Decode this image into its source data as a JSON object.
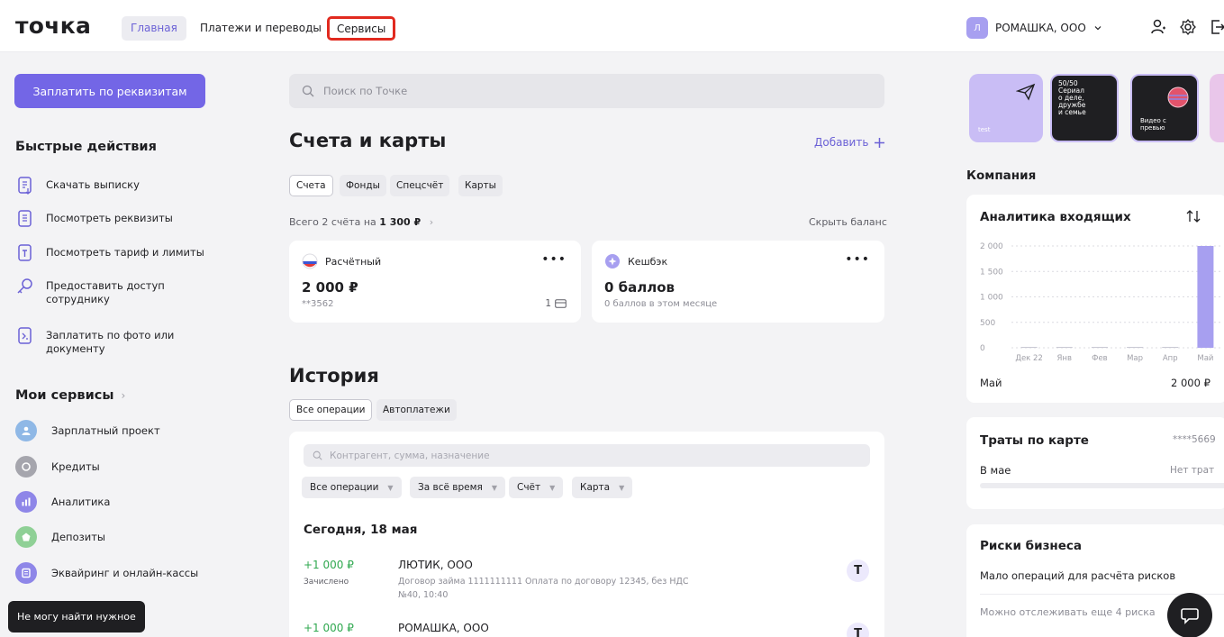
{
  "header": {
    "logo": "точка",
    "nav": [
      "Главная",
      "Платежи и переводы",
      "Сервисы"
    ],
    "company_initial": "Л",
    "company_name": "РОМАШКА, ООО"
  },
  "sidebar": {
    "pay_button": "Заплатить по реквизитам",
    "quick_title": "Быстрые действия",
    "quick_actions": [
      "Скачать выписку",
      "Посмотреть реквизиты",
      "Посмотреть тариф и лимиты",
      "Предоставить доступ\nсотруднику",
      "Заплатить по фото или\nдокументу"
    ],
    "services_title": "Мои сервисы",
    "services": [
      {
        "label": "Зарплатный проект",
        "color": "#8fb8e6"
      },
      {
        "label": "Кредиты",
        "color": "#a5a5ad"
      },
      {
        "label": "Аналитика",
        "color": "#8e86e8"
      },
      {
        "label": "Депозиты",
        "color": "#8fd096"
      },
      {
        "label": "Эквайринг и онлайн-кассы",
        "color": "#8e86e8"
      }
    ],
    "help_pill": "Не могу найти нужное"
  },
  "main": {
    "search_placeholder": "Поиск по Точке",
    "accounts_title": "Счета и карты",
    "add_label": "Добавить",
    "account_tabs": [
      "Счета",
      "Фонды",
      "Спецсчёт",
      "Карты"
    ],
    "summary_prefix": "Всего 2 счёта на ",
    "summary_total": "1 300 ₽",
    "hide_balance": "Скрыть баланс",
    "cards": [
      {
        "title": "Расчётный",
        "amount": "2 000 ₽",
        "sub": "**3562",
        "count": "1"
      },
      {
        "title": "Кешбэк",
        "amount": "0 баллов",
        "sub": "0 баллов в этом месяце"
      }
    ],
    "history_title": "История",
    "history_tabs": [
      "Все операции",
      "Автоплатежи"
    ],
    "history_search_placeholder": "Контрагент, сумма, назначение",
    "filters": [
      "Все операции",
      "За всё время",
      "Счёт",
      "Карта"
    ],
    "day_header": "Сегодня, 18 мая",
    "operations": [
      {
        "amount": "+1 000 ₽",
        "status": "Зачислено",
        "name": "ЛЮТИК, ООО",
        "desc": "Договор займа 1111111111 Оплата по договору 12345, без НДС",
        "meta": "№40, 10:40",
        "badge": "Т"
      },
      {
        "amount": "+1 000 ₽",
        "status": "",
        "name": "РОМАШКА, ООО",
        "desc": "",
        "meta": "",
        "badge": "Т"
      }
    ]
  },
  "right": {
    "stories": [
      {
        "label": "test",
        "color": "#c9bdf5"
      },
      {
        "label": "50/50\nСериал\nо деле,\nдружбе\nи семье",
        "color": "#1f1f22"
      },
      {
        "label": "Видео с\nпревью",
        "color": "#1f1f22"
      },
      {
        "label": "",
        "color": "#e9c6ea"
      }
    ],
    "company_title": "Компания",
    "analytics_title": "Аналитика входящих",
    "chart_month": "Май",
    "chart_month_value": "2 000 ₽",
    "card_spend_title": "Траты по карте",
    "card_mask": "****5669",
    "card_spend_period": "В мае",
    "card_spend_value": "Нет трат",
    "risks_title": "Риски бизнеса",
    "risks_text": "Мало операций для расчёта рисков",
    "risks_more": "Можно отслеживать еще 4 риска"
  },
  "chart_data": {
    "type": "bar",
    "categories": [
      "Дек 22",
      "Янв",
      "Фев",
      "Мар",
      "Апр",
      "Май"
    ],
    "values": [
      0,
      0,
      0,
      0,
      0,
      2000
    ],
    "y_ticks": [
      0,
      500,
      1000,
      1500,
      2000
    ],
    "ylim": [
      0,
      2000
    ],
    "bar_color": "#a79ff0",
    "grid": true
  }
}
